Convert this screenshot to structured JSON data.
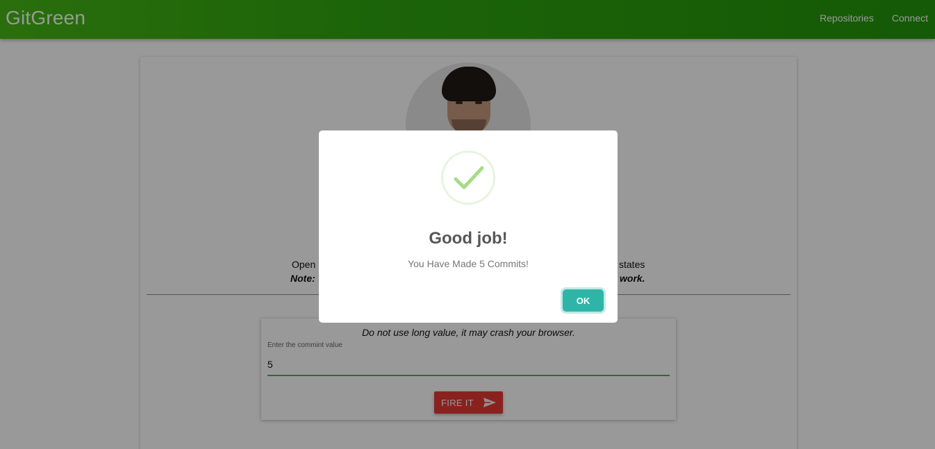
{
  "navbar": {
    "brand": "GitGreen",
    "links": [
      "Repositories",
      "Connect"
    ]
  },
  "profile": {
    "desc_line1_left": "Open",
    "desc_line1_right": "states",
    "desc_line2_left": "Note:",
    "desc_line2_right": "work."
  },
  "form": {
    "warning": "Do not use long value, it may crash your browser.",
    "label": "Enter the commint value",
    "value": "5",
    "button_label": "FIRE IT"
  },
  "modal": {
    "title": "Good job!",
    "text": "You Have Made 5 Commits!",
    "ok_label": "OK"
  },
  "colors": {
    "navbar": "#2fa70f",
    "fire_button": "#e53935",
    "ok_button": "#2fb5a8",
    "check": "#a5dc86",
    "input_underline": "#4caf50"
  },
  "icons": {
    "avatar": "profile-photo",
    "send": "send-icon",
    "success": "check-icon"
  }
}
